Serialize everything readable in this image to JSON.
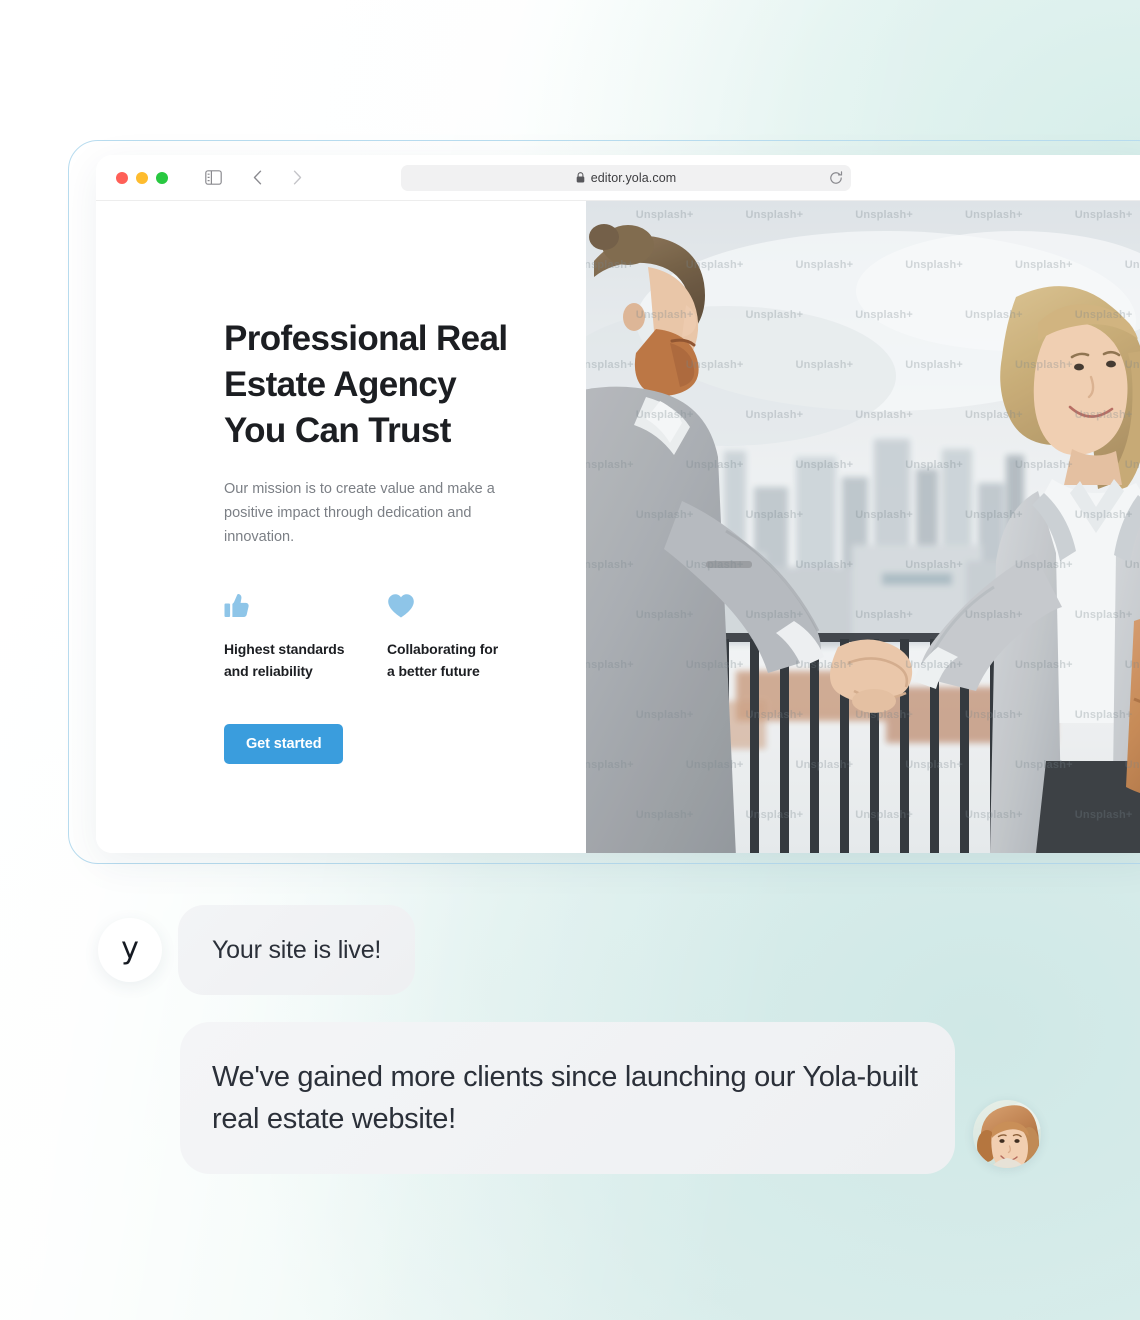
{
  "browser": {
    "traffic_lights": [
      "close",
      "minimize",
      "maximize"
    ],
    "sidebar_toggle_icon": "sidebar-toggle-icon",
    "back_icon": "chevron-left-icon",
    "forward_icon": "chevron-right-icon",
    "shield_icon": "shield-icon",
    "lock_icon": "lock-icon",
    "url": "editor.yola.com",
    "reload_icon": "reload-icon"
  },
  "site": {
    "hero": {
      "title_line_1": "Professional Real",
      "title_line_2": "Estate Agency",
      "title_line_3": "You Can Trust",
      "subtitle": "Our mission is to create value and make a positive impact through dedication and innovation.",
      "cta_label": "Get started"
    },
    "features": [
      {
        "icon": "thumbs-up-icon",
        "label_line_1": "Highest standards",
        "label_line_2": "and reliability"
      },
      {
        "icon": "heart-icon",
        "label_line_1": "Collaborating for",
        "label_line_2": "a better future"
      }
    ],
    "photo": {
      "alt": "Two business people in gray suits shaking hands on a rooftop terrace above a blurred cityscape",
      "watermark_text": "Unsplash+"
    }
  },
  "chat": {
    "messages": [
      {
        "avatar_glyph": "y",
        "avatar_name": "yola-logo-avatar",
        "text": "Your site is live!"
      },
      {
        "avatar_name": "customer-photo-avatar",
        "text": "We've gained more clients since launching our Yola-built real estate website!"
      }
    ]
  },
  "colors": {
    "accent_blue": "#3a9ddd",
    "icon_blue": "#8ec5e8",
    "heading": "#1c1e22",
    "body_text": "#7b7f85",
    "bubble_bg": "#f2f3f5",
    "window_border": "#b8dcef",
    "page_bg_mint": "#e2f1ef"
  }
}
